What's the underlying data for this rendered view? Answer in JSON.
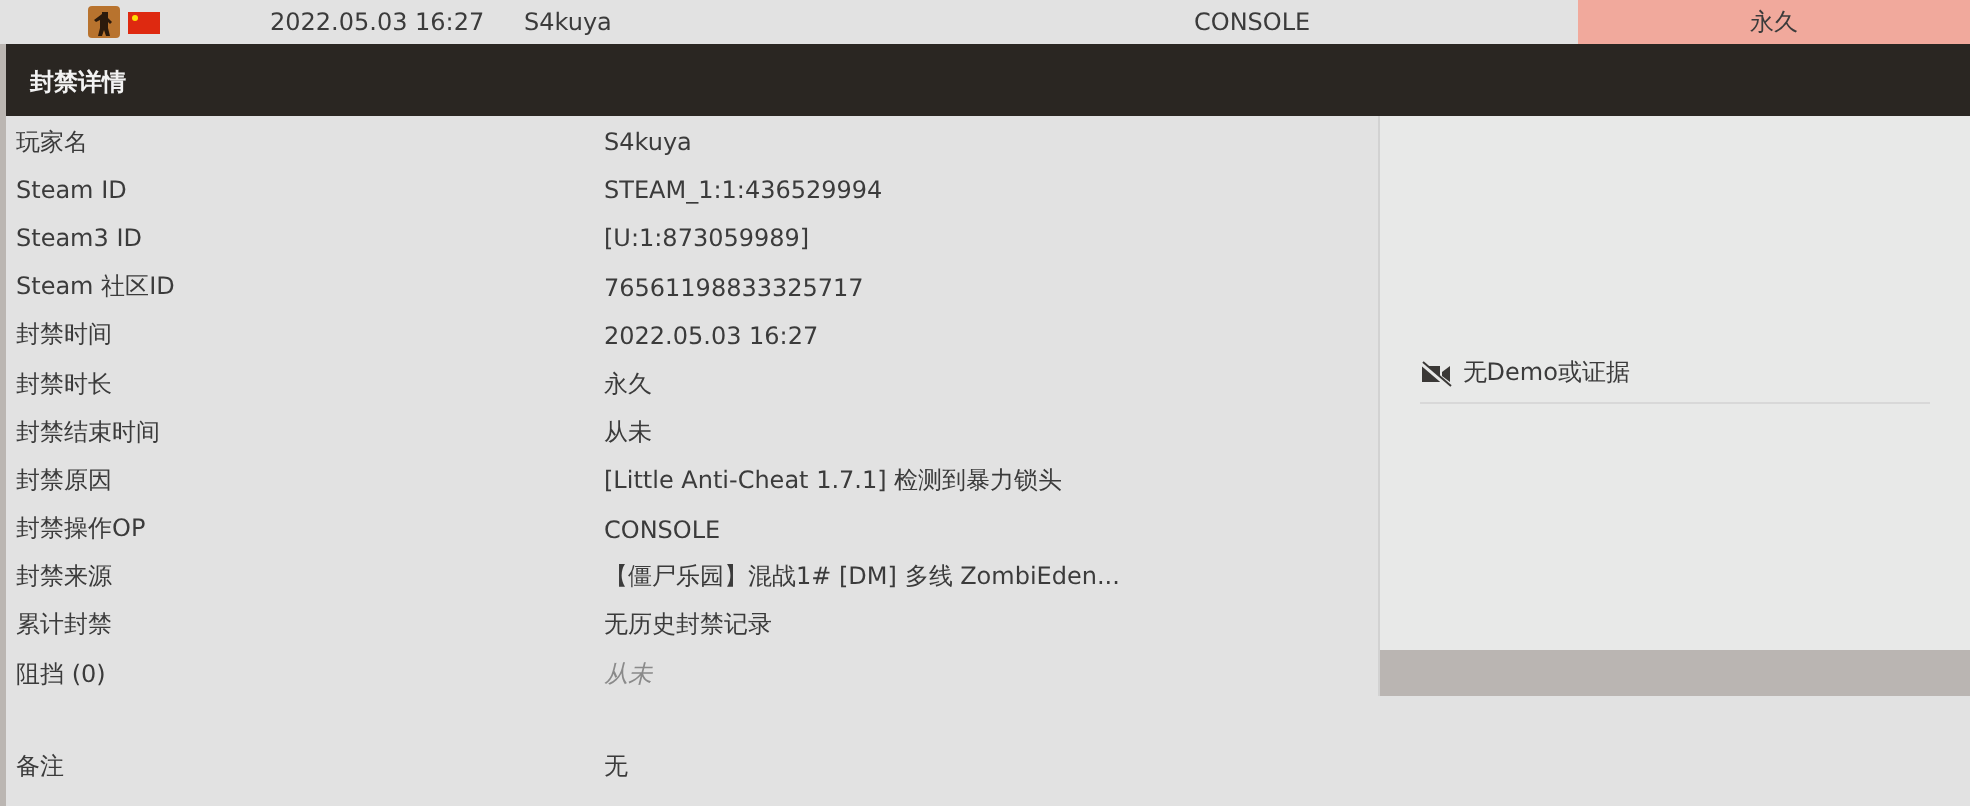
{
  "ban_row": {
    "date": "2022.05.03 16:27",
    "player": "S4kuya",
    "admin": "CONSOLE",
    "length": "永久"
  },
  "details": {
    "title": "封禁详情",
    "rows": [
      {
        "label": "玩家名",
        "value": "S4kuya",
        "muted": false
      },
      {
        "label": "Steam ID",
        "value": "STEAM_1:1:436529994",
        "muted": false
      },
      {
        "label": "Steam3 ID",
        "value": "[U:1:873059989]",
        "muted": false
      },
      {
        "label": "Steam 社区ID",
        "value": "76561198833325717",
        "muted": false
      },
      {
        "label": "封禁时间",
        "value": "2022.05.03 16:27",
        "muted": false
      },
      {
        "label": "封禁时长",
        "value": "永久",
        "muted": false
      },
      {
        "label": "封禁结束时间",
        "value": "从未",
        "muted": false
      },
      {
        "label": "封禁原因",
        "value": "[Little Anti-Cheat 1.7.1] 检测到暴力锁头",
        "muted": false
      },
      {
        "label": "封禁操作OP",
        "value": "CONSOLE",
        "muted": false
      },
      {
        "label": "封禁来源",
        "value": "【僵尸乐园】混战1# [DM] 多线 ZombiEden...",
        "muted": false
      },
      {
        "label": "累计封禁",
        "value": "无历史封禁记录",
        "muted": false
      },
      {
        "label": "阻挡 (0)",
        "value": "从未",
        "muted": true
      }
    ],
    "evidence": "无Demo或证据",
    "note": {
      "label": "备注",
      "value": "无"
    }
  }
}
